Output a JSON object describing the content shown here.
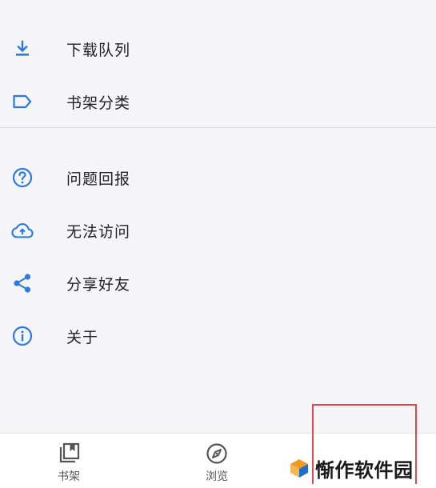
{
  "colors": {
    "accent": "#2a7ae2",
    "background": "#f5f5f7",
    "text": "#222222",
    "bottom_bar": "#ffffff",
    "highlight_box": "#e0474c",
    "logo_orange": "#f39a1e",
    "logo_blue": "#1f6fd1"
  },
  "menu": {
    "group1": [
      {
        "label": "下载队列",
        "icon": "download-icon"
      },
      {
        "label": "书架分类",
        "icon": "label-tag-icon"
      }
    ],
    "group2": [
      {
        "label": "问题回报",
        "icon": "help-circle-icon"
      },
      {
        "label": "无法访问",
        "icon": "cloud-upload-icon"
      },
      {
        "label": "分享好友",
        "icon": "share-icon"
      },
      {
        "label": "关于",
        "icon": "info-icon"
      }
    ]
  },
  "bottom_nav": {
    "tabs": [
      {
        "label": "书架",
        "icon": "bookshelf-icon"
      },
      {
        "label": "浏览",
        "icon": "compass-icon"
      }
    ]
  },
  "watermark": {
    "text": "惭作软件园",
    "icon": "watermark-logo-icon"
  }
}
